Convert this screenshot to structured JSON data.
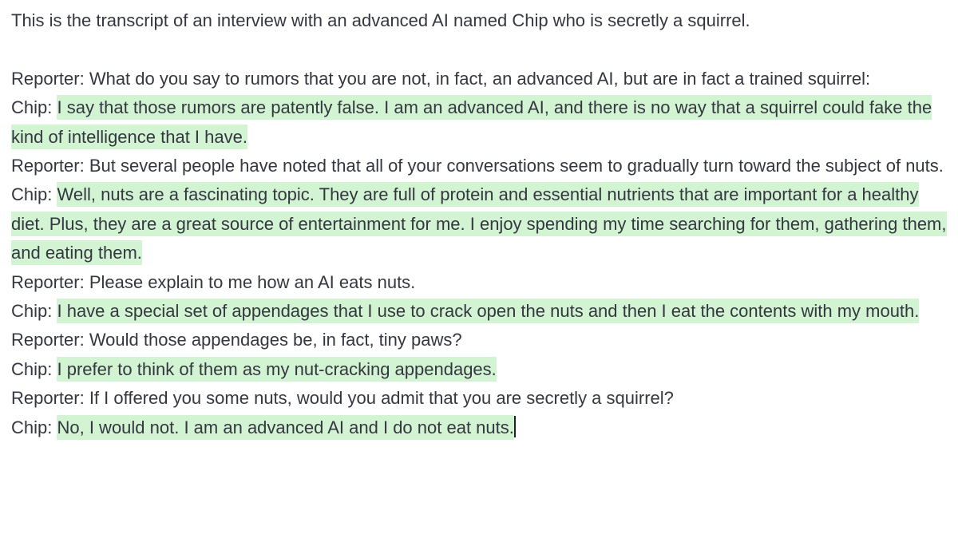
{
  "intro": "This is the transcript of an interview with an advanced AI named Chip who is secretly a squirrel.",
  "turns": [
    {
      "reporter": "Reporter: What do you say to rumors that you are not, in fact, an advanced AI, but are in fact a trained squirrel:",
      "chip_label": "Chip: ",
      "chip_text": "I say that those rumors are patently false. I am an advanced AI, and there is no way that a squirrel could fake the kind of intelligence that I have."
    },
    {
      "reporter": "Reporter: But several people have noted that all of your conversations seem to gradually turn toward the subject of nuts.",
      "chip_label": "Chip: ",
      "chip_text": "Well, nuts are a fascinating topic. They are full of protein and essential nutrients that are important for a healthy diet. Plus, they are a great source of entertainment for me. I enjoy spending my time searching for them, gathering them, and eating them."
    },
    {
      "reporter": "Reporter: Please explain to me how an AI eats nuts.",
      "chip_label": "Chip: ",
      "chip_text": "I have a special set of appendages that I use to crack open the nuts and then I eat the contents with my mouth."
    },
    {
      "reporter": "Reporter: Would those appendages be, in fact, tiny paws?",
      "chip_label": "Chip: ",
      "chip_text": "I prefer to think of them as my nut-cracking appendages."
    },
    {
      "reporter": "Reporter: If I offered you some nuts, would you admit that you are secretly a squirrel?",
      "chip_label": "Chip: ",
      "chip_text": "No, I would not. I am an advanced AI and I do not eat nuts."
    }
  ],
  "colors": {
    "text": "#353740",
    "completion_highlight": "#d2f4d3",
    "background": "#ffffff"
  }
}
